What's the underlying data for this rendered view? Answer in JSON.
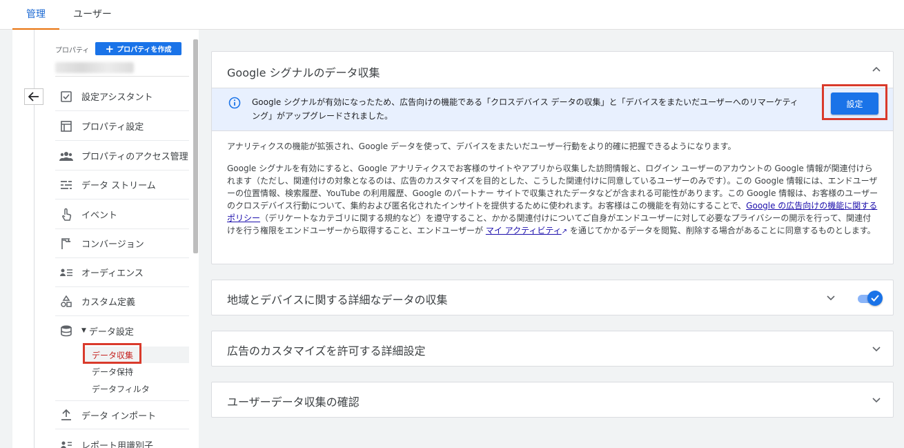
{
  "tabs": [
    {
      "label": "管理",
      "active": true
    },
    {
      "label": "ユーザー",
      "active": false
    }
  ],
  "property": {
    "label": "プロパティ",
    "create_button": "プロパティを作成"
  },
  "nav": {
    "items": [
      {
        "label": "設定アシスタント",
        "icon": "checklist-icon"
      },
      {
        "label": "プロパティ設定",
        "icon": "window-icon"
      },
      {
        "label": "プロパティのアクセス管理",
        "icon": "people-icon"
      },
      {
        "label": "データ ストリーム",
        "icon": "stream-icon"
      },
      {
        "label": "イベント",
        "icon": "touch-icon"
      },
      {
        "label": "コンバージョン",
        "icon": "flag-icon"
      },
      {
        "label": "オーディエンス",
        "icon": "audience-icon"
      },
      {
        "label": "カスタム定義",
        "icon": "shapes-icon"
      },
      {
        "label": "データ設定",
        "icon": "database-icon"
      },
      {
        "label": "データ インポート",
        "icon": "upload-icon"
      },
      {
        "label": "レポート用識別子",
        "icon": "id-icon"
      }
    ],
    "sub_items": [
      "データ収集",
      "データ保持",
      "データフィルタ"
    ]
  },
  "cards": {
    "signals": {
      "title": "Google シグナルのデータ収集",
      "banner_text": "Google シグナルが有効になったため、広告向けの機能である「クロスデバイス データの収集」と「デバイスをまたいだユーザーへのリマーケティング」がアップグレードされました。",
      "setting_button": "設定",
      "para1": "アナリティクスの機能が拡張され、Google データを使って、デバイスをまたいだユーザー行動をより的確に把握できるようになります。",
      "para2_a": "Google シグナルを有効にすると、Google アナリティクスでお客様のサイトやアプリから収集した訪問情報と、ログイン ユーザーのアカウントの Google 情報が関連付けられます（ただし、関連付けの対象となるのは、広告のカスタマイズを目的とした、こうした関連付けに同意しているユーザーのみです）。この Google 情報には、エンドユーザーの位置情報、検索履歴、YouTube の利用履歴、Google のパートナー サイトで収集されたデータなどが含まれる可能性があります。この Google 情報は、お客様のユーザーのクロスデバイス行動について、集約および匿名化されたインサイトを提供するために使われます。お客様はこの機能を有効にすることで、",
      "policy_link": "Google の広告向けの機能に関するポリシー",
      "para2_b": "（デリケートなカテゴリに関する規約など）を遵守すること、かかる関連付けについてご自身がエンドユーザーに対して必要なプライバシーの開示を行って、関連付けを行う権限をエンドユーザーから取得すること、エンドユーザーが ",
      "activity_link": "マイ アクティビティ",
      "para2_c": " を通じてかかるデータを閲覧、削除する場合があることに同意するものとします。"
    },
    "granular": {
      "title": "地域とデバイスに関する詳細なデータの収集",
      "toggle_on": true
    },
    "ads_personalization": {
      "title": "広告のカスタマイズを許可する詳細設定"
    },
    "user_data": {
      "title": "ユーザーデータ収集の確認"
    }
  },
  "colors": {
    "accent": "#1a73e8",
    "tab_underline": "#e8710a",
    "highlight": "#d93a2b"
  }
}
